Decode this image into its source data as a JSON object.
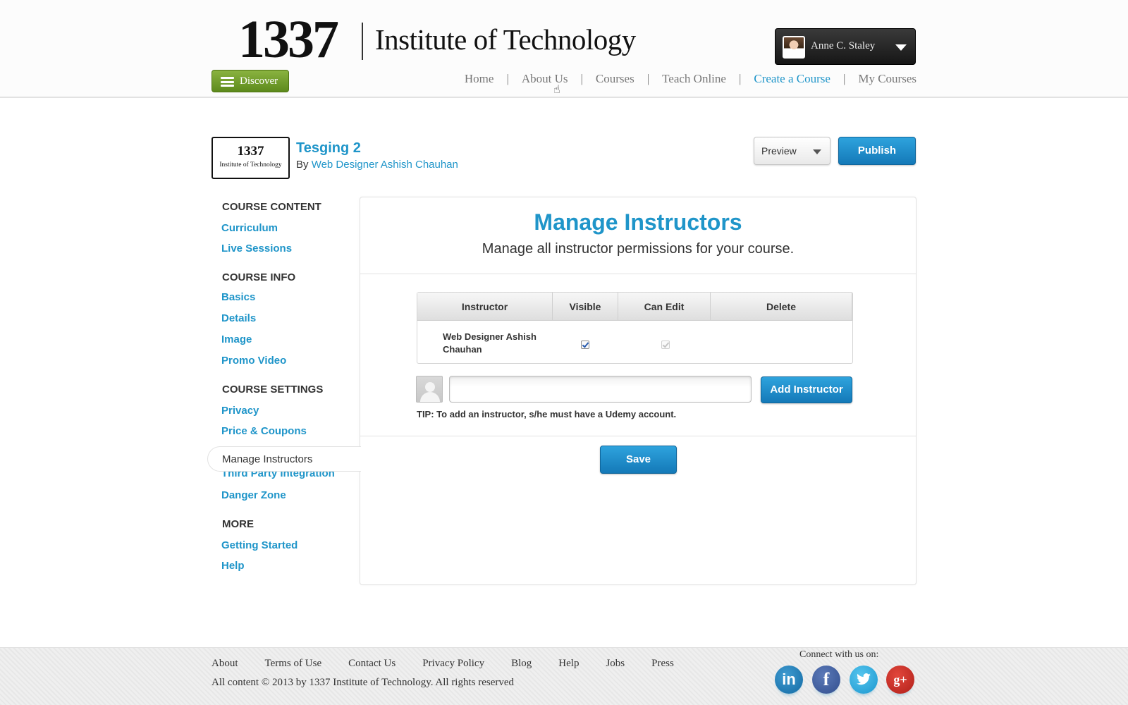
{
  "brand": {
    "number": "1337",
    "name": "Institute of Technology"
  },
  "user": {
    "name": "Anne C. Staley"
  },
  "discover": {
    "label": "Discover"
  },
  "nav": {
    "items": [
      {
        "label": "Home",
        "active": false
      },
      {
        "label": "About Us",
        "active": false
      },
      {
        "label": "Courses",
        "active": false
      },
      {
        "label": "Teach Online",
        "active": false
      },
      {
        "label": "Create a Course",
        "active": true
      },
      {
        "label": "My Courses",
        "active": false
      }
    ],
    "separator": "|"
  },
  "course": {
    "logo_number": "1337",
    "logo_name": "Institute of Technology",
    "title": "Tesging 2",
    "by_prefix": "By",
    "author": "Web Designer Ashish Chauhan",
    "preview_label": "Preview",
    "publish_label": "Publish"
  },
  "sidebar": {
    "sections": [
      {
        "heading": "COURSE CONTENT",
        "items": [
          "Curriculum",
          "Live Sessions"
        ]
      },
      {
        "heading": "COURSE INFO",
        "items": [
          "Basics",
          "Details",
          "Image",
          "Promo Video"
        ]
      },
      {
        "heading": "COURSE SETTINGS",
        "items": [
          "Privacy",
          "Price & Coupons",
          "Manage Instructors",
          "Third Party Integration",
          "Danger Zone"
        ]
      },
      {
        "heading": "MORE",
        "items": [
          "Getting Started",
          "Help"
        ]
      }
    ],
    "active_item": "Manage Instructors"
  },
  "main": {
    "title": "Manage Instructors",
    "subtitle": "Manage all instructor permissions for your course.",
    "table": {
      "columns": [
        "Instructor",
        "Visible",
        "Can Edit",
        "Delete"
      ],
      "rows": [
        {
          "instructor": "Web Designer Ashish Chauhan",
          "visible": true,
          "can_edit": true,
          "can_edit_disabled": true,
          "delete": ""
        }
      ]
    },
    "add_input": {
      "value": "",
      "placeholder": ""
    },
    "add_button": "Add Instructor",
    "tip": "TIP: To add an instructor, s/he must have a Udemy account.",
    "save_button": "Save"
  },
  "footer": {
    "links": [
      "About",
      "Terms of Use",
      "Contact Us",
      "Privacy Policy",
      "Blog",
      "Help",
      "Jobs",
      "Press"
    ],
    "copyright": "All content © 2013 by 1337 Institute of Technology. All rights reserved",
    "connect_label": "Connect with us on:",
    "social": [
      {
        "name": "linkedin-icon",
        "glyph": "in"
      },
      {
        "name": "facebook-icon",
        "glyph": "f"
      },
      {
        "name": "twitter-icon",
        "glyph": "t"
      },
      {
        "name": "google-plus-icon",
        "glyph": "g+"
      }
    ]
  },
  "colors": {
    "accent": "#1f95c9",
    "discover_green": "#6f9a2a",
    "button_blue": "#1a86c6",
    "user_menu_dark": "#222222"
  }
}
